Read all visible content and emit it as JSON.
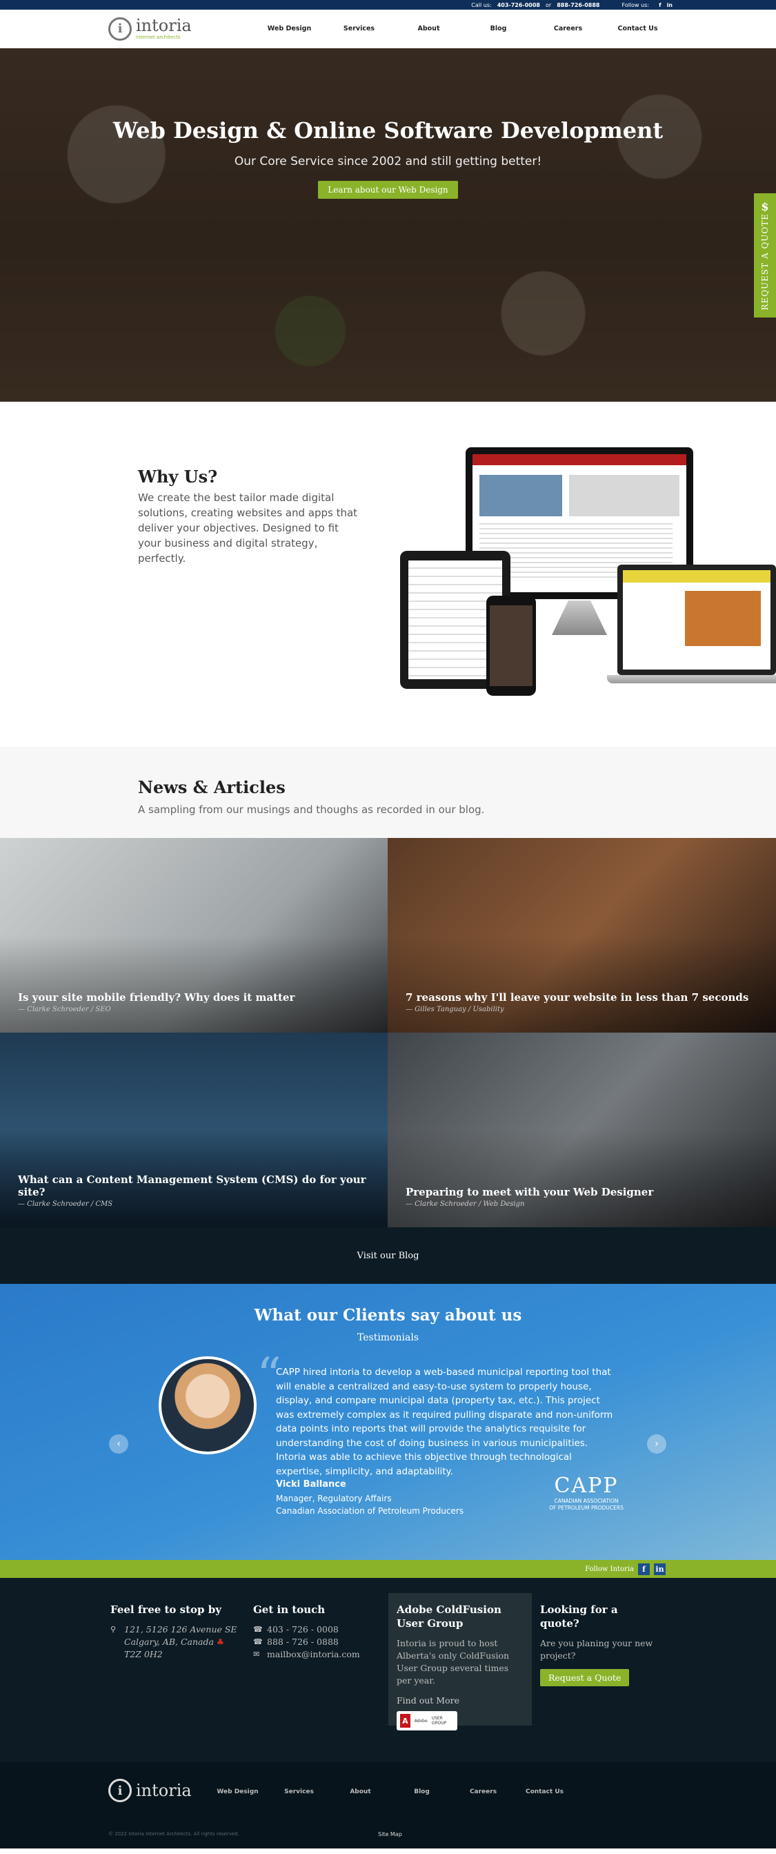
{
  "topbar": {
    "call_label": "Call us:",
    "phone1": "403-726-0008",
    "or_label": "or",
    "phone2": "888-726-0888",
    "follow_label": "Follow us:",
    "facebook_glyph": "f",
    "linkedin_glyph": "in"
  },
  "brand": {
    "name": "intoria",
    "tagline": "internet architects",
    "mark": "i"
  },
  "nav": [
    "Web Design",
    "Services",
    "About",
    "Blog",
    "Careers",
    "Contact Us"
  ],
  "hero": {
    "title": "Web Design & Online Software Development",
    "subtitle": "Our Core Service since 2002 and still getting better!",
    "cta": "Learn about our Web Design"
  },
  "quote_tab": {
    "symbol": "$",
    "label": "REQUEST A QUOTE"
  },
  "why": {
    "title": "Why Us?",
    "body": "We create the best tailor made digital solutions, creating websites and apps that deliver your objectives. Designed to fit your business and digital strategy, perfectly."
  },
  "news": {
    "title": "News & Articles",
    "subtitle": "A sampling from our musings and thoughs as recorded in our blog.",
    "items": [
      {
        "title": "Is your site mobile friendly? Why does it matter",
        "meta": "— Clarke Schroeder / SEO"
      },
      {
        "title": "7 reasons why I'll leave your website in less than 7 seconds",
        "meta": "— Gilles Tanguay / Usability"
      },
      {
        "title": "What can a Content Management System (CMS) do for your site?",
        "meta": "— Clarke Schroeder / CMS"
      },
      {
        "title": "Preparing to meet with your Web Designer",
        "meta": "— Clarke Schroeder / Web Design"
      }
    ],
    "blog_link": "Visit our Blog"
  },
  "testimonials": {
    "title": "What our Clients say about us",
    "subtitle": "Testimonials",
    "quote": "CAPP hired intoria to develop a web-based municipal reporting tool that will enable a centralized and easy-to-use system to properly house, display, and compare municipal data (property tax, etc.). This project was extremely complex as it required pulling disparate and non-uniform data points into reports that will provide the analytics requisite for understanding the cost of doing business in various municipalities. Intoria was able to achieve this objective through technological expertise, simplicity, and adaptability.",
    "name": "Vicki Ballance",
    "role": "Manager, Regulatory Affairs",
    "company": "Canadian Association of Petroleum Producers",
    "logo_big": "CAPP",
    "logo_line1": "CANADIAN ASSOCIATION",
    "logo_line2": "OF PETROLEUM PRODUCERS",
    "prev": "‹",
    "next": "›"
  },
  "follow": {
    "label": "Follow Intoria",
    "facebook": "f",
    "linkedin": "in"
  },
  "footer": {
    "visit": {
      "title": "Feel free to stop by",
      "line1": "121, 5126 126 Avenue SE",
      "line2": "Calgary, AB, Canada",
      "line3": "T2Z 0H2"
    },
    "contact": {
      "title": "Get in touch",
      "phone1": "403 - 726 - 0008",
      "phone2": "888 - 726 - 0888",
      "email": "mailbox@intoria.com"
    },
    "coldfusion": {
      "title": "Adobe ColdFusion User Group",
      "body": "Intoria is proud to host Alberta's only ColdFusion User Group several times per year.",
      "link": "Find out More",
      "badge_mark": "A",
      "badge_brand": "Adobe",
      "badge_text": "USER GROUP"
    },
    "quote": {
      "title": "Looking for a quote?",
      "body": "Are you planing your new project?",
      "button": "Request a Quote"
    }
  },
  "bottom": {
    "nav": [
      "Web Design",
      "Services",
      "About",
      "Blog",
      "Careers",
      "Contact Us"
    ],
    "copyright": "© 2022 Intoria Internet Architects. All rights reserved.",
    "sitemap": "Site Map"
  }
}
